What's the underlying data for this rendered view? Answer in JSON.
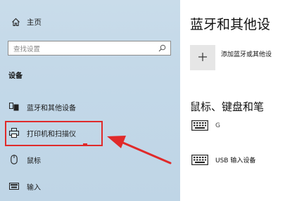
{
  "sidebar": {
    "home_label": "主页",
    "search_placeholder": "查找设置",
    "section_title": "设备",
    "items": [
      {
        "label": "蓝牙和其他设备",
        "icon": "bluetooth-devices-icon"
      },
      {
        "label": "打印机和扫描仪",
        "icon": "printer-icon"
      },
      {
        "label": "鼠标",
        "icon": "mouse-icon"
      },
      {
        "label": "输入",
        "icon": "keyboard-icon"
      }
    ]
  },
  "main": {
    "title": "蓝牙和其他设",
    "add_label": "添加蓝牙或其他设",
    "section_title": "鼠标、键盘和笔",
    "devices": [
      {
        "name": "G",
        "icon": "keyboard-icon"
      },
      {
        "name": "USB 输入设备",
        "icon": "keyboard-icon"
      }
    ]
  },
  "colors": {
    "highlight": "#e02a2a",
    "sidebar_bg": "#c3d8e8"
  }
}
